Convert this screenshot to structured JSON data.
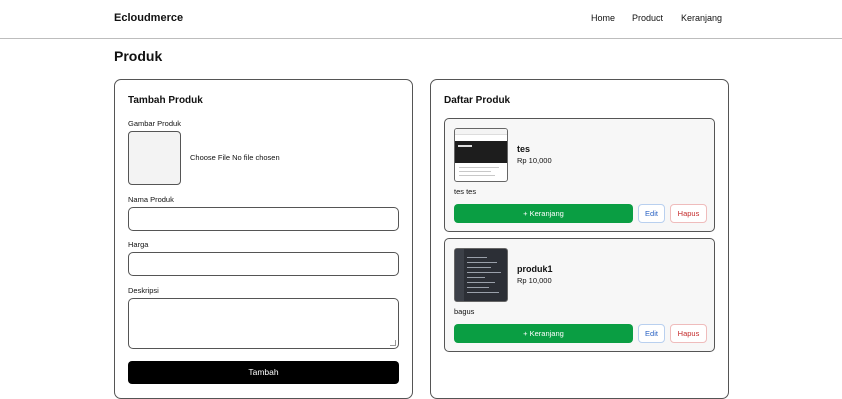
{
  "navbar": {
    "brand": "Ecloudmerce",
    "links": [
      "Home",
      "Product",
      "Keranjang"
    ]
  },
  "page": {
    "title": "Produk"
  },
  "form": {
    "title": "Tambah Produk",
    "image_label": "Gambar Produk",
    "file_input_text": "Choose File No file chosen",
    "name_label": "Nama Produk",
    "price_label": "Harga",
    "description_label": "Deskripsi",
    "submit_label": "Tambah"
  },
  "product_list": {
    "title": "Daftar Produk",
    "cart_label": "+ Keranjang",
    "edit_label": "Edit",
    "delete_label": "Hapus",
    "items": [
      {
        "name": "tes",
        "price": "Rp 10,000",
        "description": "tes tes"
      },
      {
        "name": "produk1",
        "price": "Rp 10,000",
        "description": "bagus"
      }
    ]
  },
  "colors": {
    "cart_button": "#0a9e43",
    "submit_button": "#000000",
    "edit_text": "#2b64c4",
    "delete_text": "#c42b2b"
  }
}
